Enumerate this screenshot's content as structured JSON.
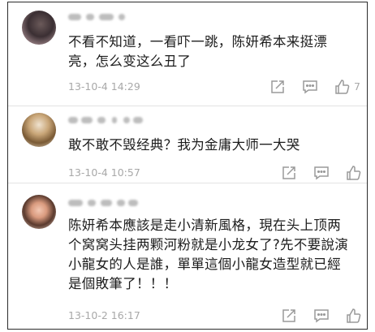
{
  "comments": [
    {
      "text": "不看不知道，一看吓一跳，陈妍希本来挺漂亮，怎么变这么丑了",
      "time": "13-10-4 14:29",
      "like_count": "7"
    },
    {
      "text": "敢不敢不毁经典？我为金庸大师一大哭",
      "time": "13-10-4 10:57",
      "like_count": ""
    },
    {
      "text": "陈妍希本應該是走小清新風格，現在头上顶两个窝窝头挂两颗河粉就是小龙女了?先不要說演小龍女的人是誰，單單這個小龍女造型就已經是個敗筆了！！！",
      "time": "13-10-2 16:17",
      "like_count": ""
    }
  ],
  "icons": {
    "share": "share-icon",
    "reply": "comment-icon",
    "like": "thumbs-up-icon"
  },
  "colors": {
    "text": "#1c1c1c",
    "meta": "#a8a8a8",
    "icon": "#9a9a9a",
    "divider": "#e3e3e3",
    "frame_border": "#2b2b2b"
  }
}
